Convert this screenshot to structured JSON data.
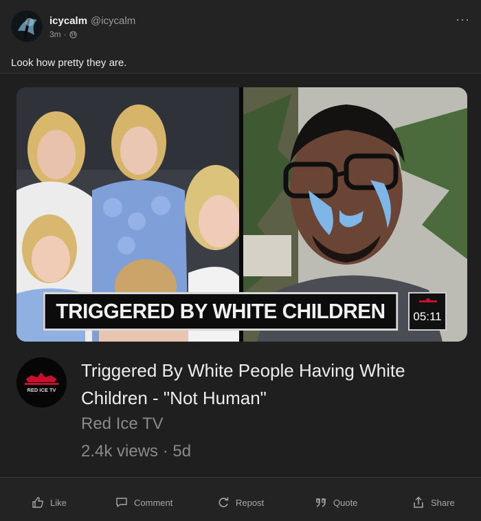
{
  "post": {
    "username": "icycalm",
    "handle": "@icycalm",
    "time": "3m",
    "dot": "·",
    "text": "Look how pretty they are.",
    "more": "···"
  },
  "embed": {
    "thumbnail_banner": "TRIGGERED BY WHITE CHILDREN",
    "duration": "05:11",
    "channel_logo_text": "RED ICE TV",
    "title": "Triggered By White People Having White Children - \"Not Human\"",
    "channel": "Red Ice TV",
    "stats": "2.4k views · 5d"
  },
  "actions": {
    "like": "Like",
    "comment": "Comment",
    "repost": "Repost",
    "quote": "Quote",
    "share": "Share"
  },
  "colors": {
    "background": "#232323",
    "card": "#1f1f1f",
    "muted_text": "#8a8a8a",
    "brand_red": "#c8102e"
  },
  "icons": {
    "avatar": "user-avatar",
    "globe": "globe-icon",
    "more": "more-horizontal-icon",
    "like": "thumbs-up-icon",
    "comment": "comment-icon",
    "repost": "repost-icon",
    "quote": "quote-icon",
    "share": "share-icon"
  }
}
